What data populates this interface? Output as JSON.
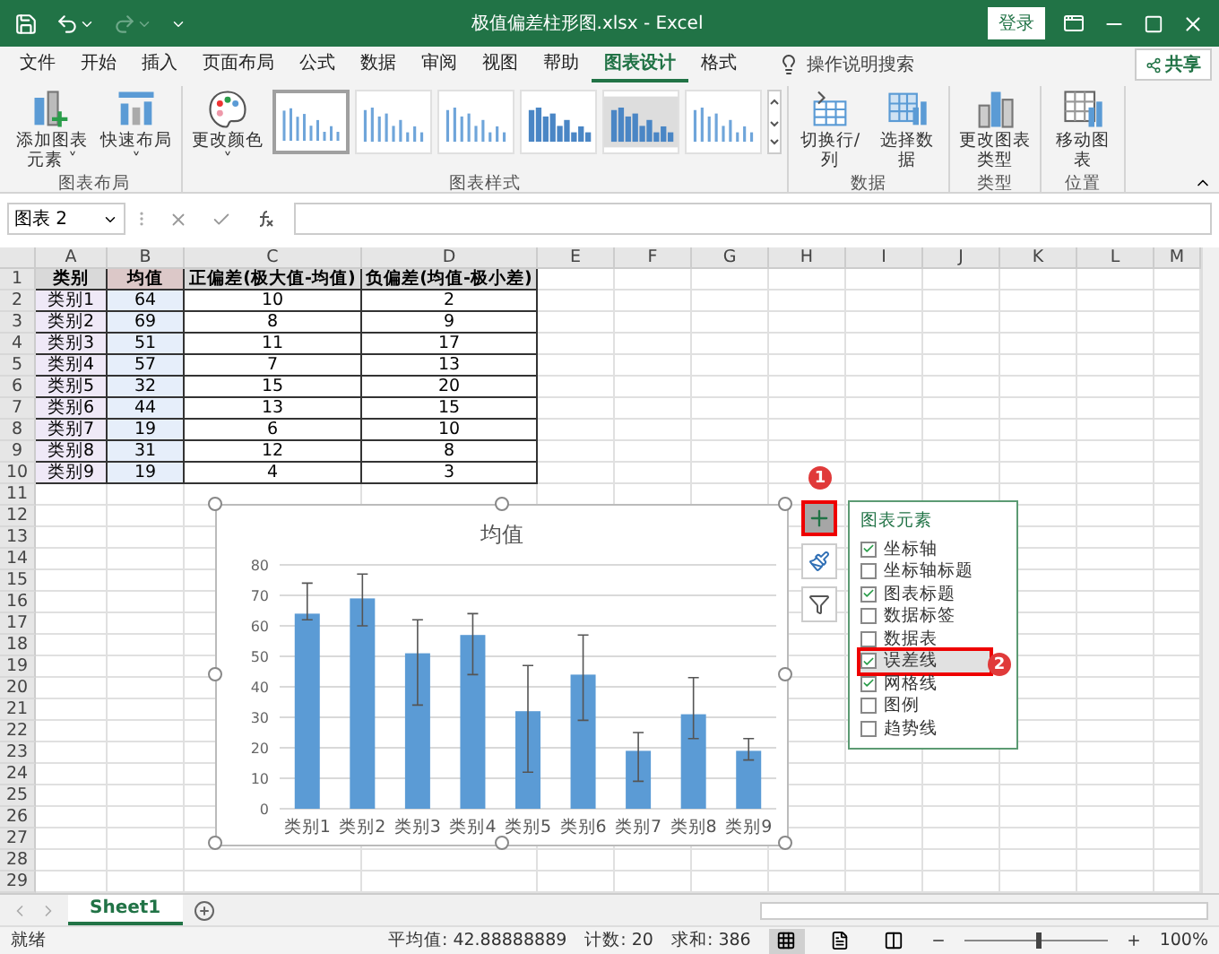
{
  "window": {
    "title": "极值偏差柱形图.xlsx  -  Excel",
    "sign_in": "登录"
  },
  "ribbon_tabs": [
    {
      "label": "文件",
      "selected": false
    },
    {
      "label": "开始",
      "selected": false
    },
    {
      "label": "插入",
      "selected": false
    },
    {
      "label": "页面布局",
      "selected": false
    },
    {
      "label": "公式",
      "selected": false
    },
    {
      "label": "数据",
      "selected": false
    },
    {
      "label": "审阅",
      "selected": false
    },
    {
      "label": "视图",
      "selected": false
    },
    {
      "label": "帮助",
      "selected": false
    },
    {
      "label": "图表设计",
      "selected": true
    },
    {
      "label": "格式",
      "selected": false
    }
  ],
  "tell_me": "操作说明搜索",
  "share": "共享",
  "ribbon_groups": [
    {
      "label": "图表布局",
      "commands": [
        {
          "kind": "add-element",
          "label": "添加图表元素 ˅"
        },
        {
          "kind": "quick-layout",
          "label": "快速布局 ˅"
        }
      ]
    },
    {
      "label": "图表样式",
      "commands": [
        {
          "kind": "colors",
          "label": "更改颜色 ˅"
        }
      ],
      "styles": [
        {
          "selected": true
        },
        {
          "selected": false
        },
        {
          "selected": false
        },
        {
          "selected": false
        },
        {
          "selected": false
        },
        {
          "selected": false
        }
      ]
    },
    {
      "label": "数据",
      "commands": [
        {
          "kind": "switch",
          "label": "切换行/列"
        },
        {
          "kind": "select-data",
          "label": "选择数据"
        }
      ]
    },
    {
      "label": "类型",
      "commands": [
        {
          "kind": "change-type",
          "label": "更改图表类型"
        }
      ]
    },
    {
      "label": "位置",
      "commands": [
        {
          "kind": "move",
          "label": "移动图表"
        }
      ]
    }
  ],
  "name_box": "图表 2",
  "sheet": {
    "columns": [
      "A",
      "B",
      "C",
      "D",
      "E",
      "F",
      "G",
      "H",
      "I",
      "J",
      "K",
      "L",
      "M"
    ],
    "row_numbers": [
      "1",
      "2",
      "3",
      "4",
      "5",
      "6",
      "7",
      "8",
      "9",
      "10",
      "11",
      "12",
      "13",
      "14",
      "15",
      "16",
      "17",
      "18",
      "19",
      "20",
      "21",
      "22",
      "23",
      "24",
      "25",
      "26",
      "27",
      "28",
      "29"
    ],
    "rows": [
      [
        "类别",
        "均值",
        "正偏差(极大值-均值)",
        "负偏差(均值-极小差)"
      ],
      [
        "类别1",
        "64",
        "10",
        "2"
      ],
      [
        "类别2",
        "69",
        "8",
        "9"
      ],
      [
        "类别3",
        "51",
        "11",
        "17"
      ],
      [
        "类别4",
        "57",
        "7",
        "13"
      ],
      [
        "类别5",
        "32",
        "15",
        "20"
      ],
      [
        "类别6",
        "44",
        "13",
        "15"
      ],
      [
        "类别7",
        "19",
        "6",
        "10"
      ],
      [
        "类别8",
        "31",
        "12",
        "8"
      ],
      [
        "类别9",
        "19",
        "4",
        "3"
      ]
    ]
  },
  "chart": {
    "chart_data": {
      "type": "bar",
      "categories": [
        "类别1",
        "类别2",
        "类别3",
        "类别4",
        "类别5",
        "类别6",
        "类别7",
        "类别8",
        "类别9"
      ],
      "series": [
        {
          "name": "均值",
          "color": "#5b9bd5",
          "values": [
            64,
            69,
            51,
            57,
            32,
            44,
            19,
            31,
            19
          ],
          "errors": [
            [
              62,
              74
            ],
            [
              60,
              77
            ],
            [
              34,
              62
            ],
            [
              44,
              64
            ],
            [
              12,
              47
            ],
            [
              29,
              57
            ],
            [
              9,
              25
            ],
            [
              23,
              43
            ],
            [
              16,
              23
            ]
          ]
        }
      ],
      "grid": true,
      "ylim": [
        0,
        80
      ],
      "yticks": [
        0,
        10,
        20,
        30,
        40,
        50,
        60,
        70,
        80
      ]
    }
  },
  "chart_tools": [
    {
      "kind": "elements",
      "selected": true
    },
    {
      "kind": "styles",
      "selected": false
    },
    {
      "kind": "filter",
      "selected": false
    }
  ],
  "elements_panel": {
    "title": "图表元素",
    "items": [
      {
        "label": "坐标轴",
        "checked": true,
        "selected": false
      },
      {
        "label": "坐标轴标题",
        "checked": false,
        "selected": false
      },
      {
        "label": "图表标题",
        "checked": true,
        "selected": false
      },
      {
        "label": "数据标签",
        "checked": false,
        "selected": false
      },
      {
        "label": "数据表",
        "checked": false,
        "selected": false
      },
      {
        "label": "误差线",
        "checked": true,
        "selected": true
      },
      {
        "label": "网格线",
        "checked": true,
        "selected": false
      },
      {
        "label": "图例",
        "checked": false,
        "selected": false
      },
      {
        "label": "趋势线",
        "checked": false,
        "selected": false
      }
    ]
  },
  "callouts": [
    "1",
    "2"
  ],
  "sheet_tabs": [
    {
      "label": "Sheet1",
      "selected": true
    }
  ],
  "status_bar": {
    "mode": "就绪",
    "average": "平均值: 42.88888889",
    "count": "计数: 20",
    "sum": "求和: 386",
    "views": [
      {
        "kind": "normal",
        "selected": true
      },
      {
        "kind": "layout",
        "selected": false
      },
      {
        "kind": "break",
        "selected": false
      }
    ],
    "zoom_slider": {
      "level": 0.5
    },
    "zoom": "100%"
  }
}
